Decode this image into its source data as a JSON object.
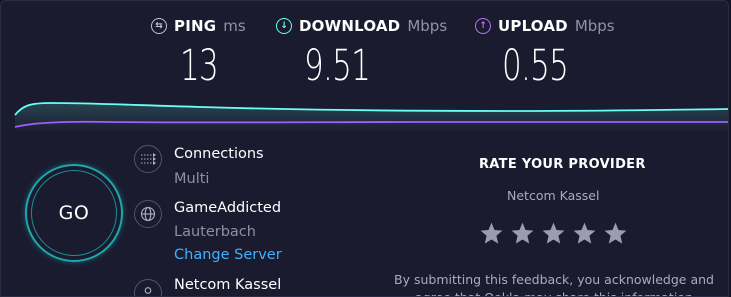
{
  "metrics": {
    "ping": {
      "label": "PING",
      "unit": "ms",
      "value": "13",
      "icon": "ping-icon",
      "color": "#c1c3d4"
    },
    "download": {
      "label": "DOWNLOAD",
      "unit": "Mbps",
      "value": "9.51",
      "icon": "download-icon",
      "color": "#6afff3"
    },
    "upload": {
      "label": "UPLOAD",
      "unit": "Mbps",
      "value": "0.55",
      "icon": "upload-icon",
      "color": "#bf71ff"
    }
  },
  "graph": {
    "download_color": "#6afff3",
    "upload_color": "#9f5fff"
  },
  "go": {
    "label": "GO"
  },
  "info": {
    "connections": {
      "title": "Connections",
      "value": "Multi",
      "icon": "connections-icon"
    },
    "server": {
      "title": "GameAddicted",
      "location": "Lauterbach",
      "change_label": "Change Server",
      "icon": "globe-icon"
    },
    "provider": {
      "title": "Netcom Kassel",
      "icon": "user-icon"
    }
  },
  "rate": {
    "title": "RATE YOUR PROVIDER",
    "provider": "Netcom Kassel",
    "star_count": 5,
    "feedback_text": "By submitting this feedback, you acknowledge and agree that Ookla may share this information"
  }
}
